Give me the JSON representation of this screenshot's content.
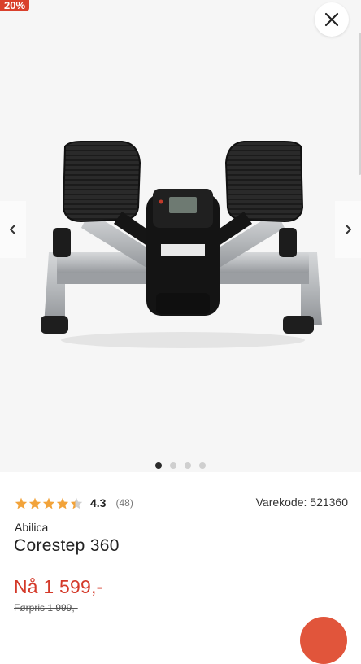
{
  "badge": {
    "discount": "20%"
  },
  "gallery": {
    "image_name": "stepper-product-image",
    "dot_count": 4,
    "active_dot": 0,
    "icons": {
      "close": "close-icon",
      "prev": "chevron-left-icon",
      "next": "chevron-right-icon"
    },
    "background": "#f6f6f6"
  },
  "rating": {
    "value": "4.3",
    "count": "(48)",
    "stars": 4.3,
    "star_color": "#f2a33a"
  },
  "product": {
    "sku": "Varekode: 521360",
    "brand": "Abilica",
    "name": "Corestep 360",
    "price": "Nå 1 599,-",
    "old_price": "Førpris 1 999,-"
  },
  "colors": {
    "price": "#d43a2a",
    "badge": "#d9402c",
    "fab": "#e1553b"
  }
}
